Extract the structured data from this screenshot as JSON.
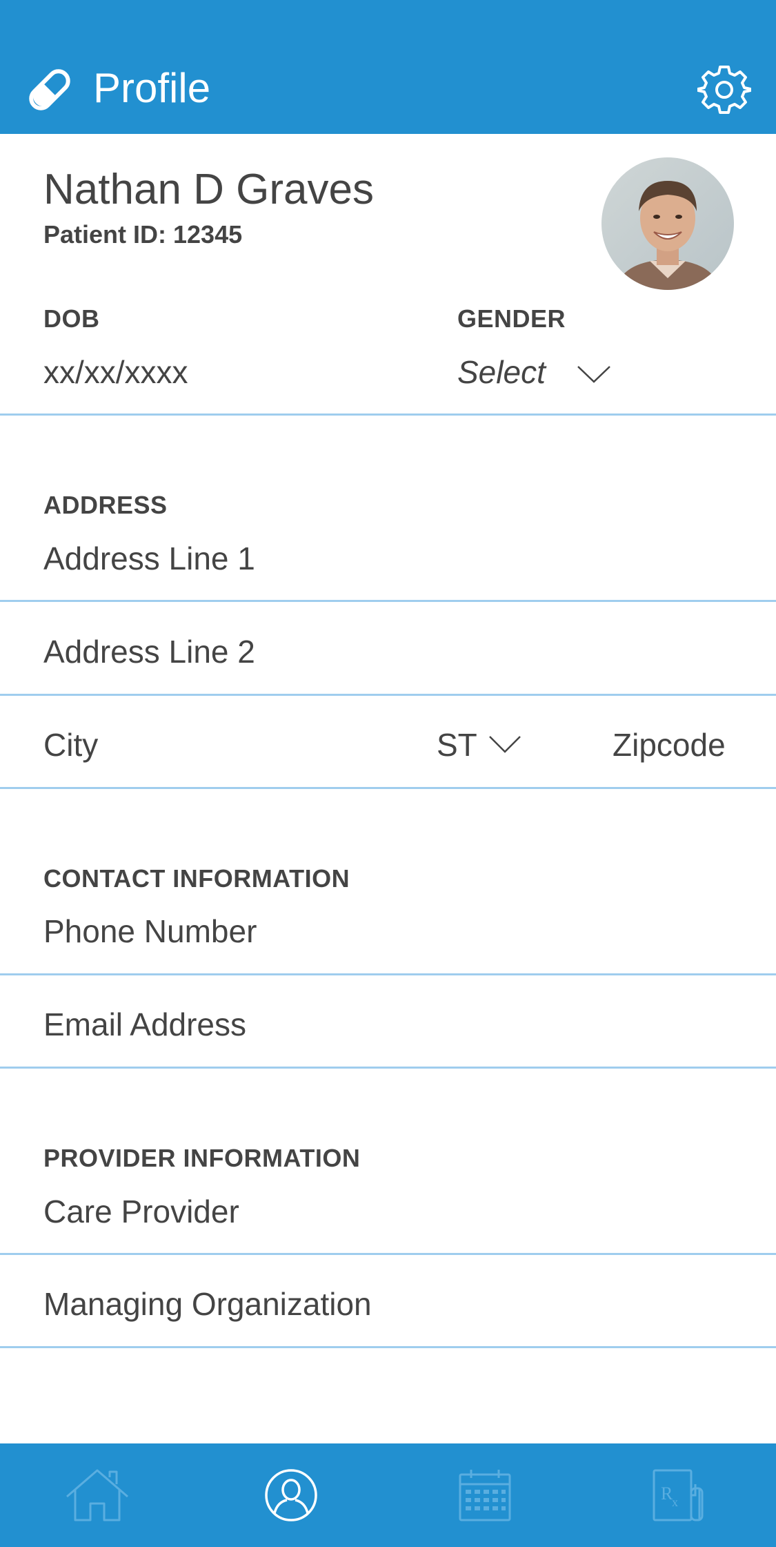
{
  "header": {
    "title": "Profile",
    "logo_icon": "pill-icon",
    "settings_icon": "gear-icon",
    "background": "#2290d0"
  },
  "patient": {
    "name": "Nathan D Graves",
    "id_text": "Patient ID: 12345",
    "avatar_alt": "Patient photo"
  },
  "demographics": {
    "dob_label": "DOB",
    "dob_value": "xx/xx/xxxx",
    "gender_label": "GENDER",
    "gender_value": "Select"
  },
  "address": {
    "section_label": "ADDRESS",
    "line1_placeholder": "Address Line 1",
    "line2_placeholder": "Address Line 2",
    "city_placeholder": "City",
    "state_placeholder": "ST",
    "zip_placeholder": "Zipcode"
  },
  "contact": {
    "section_label": "CONTACT INFORMATION",
    "phone_placeholder": "Phone Number",
    "email_placeholder": "Email Address"
  },
  "provider": {
    "section_label": "PROVIDER INFORMATION",
    "care_provider_placeholder": "Care Provider",
    "organization_placeholder": "Managing Organization"
  },
  "tabbar": {
    "tabs": [
      {
        "icon": "home-icon",
        "active": false
      },
      {
        "icon": "user-profile-icon",
        "active": true
      },
      {
        "icon": "calendar-icon",
        "active": false
      },
      {
        "icon": "prescription-icon",
        "active": false
      }
    ]
  },
  "colors": {
    "primary": "#2290d0",
    "divider": "#9fcdee",
    "text": "#444444",
    "inactive_icon": "#5aaee0"
  }
}
